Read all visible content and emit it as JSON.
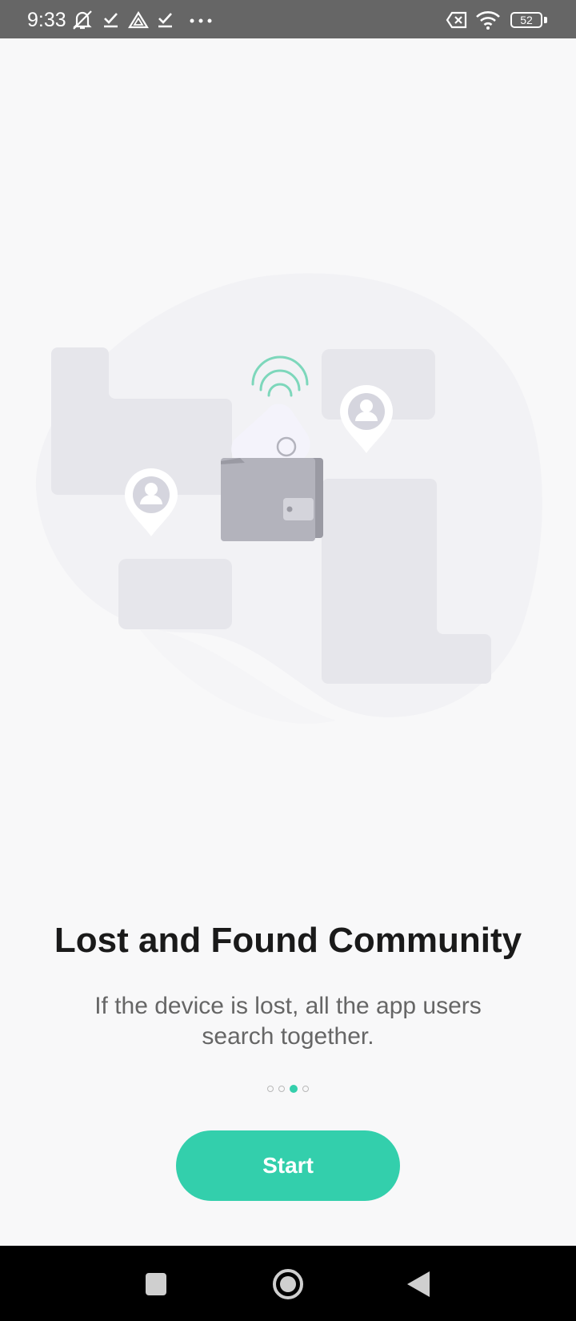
{
  "status_bar": {
    "time": "9:33",
    "battery": "52"
  },
  "onboarding": {
    "title": "Lost and Found Community",
    "subtitle": "If the device is lost, all the app users search together.",
    "page_count": 4,
    "active_page": 3,
    "start_label": "Start"
  },
  "colors": {
    "accent": "#33cfac",
    "status_bar": "#666666",
    "background": "#f8f8f9"
  },
  "icons": {
    "status_left": [
      "mute-icon",
      "check-icon",
      "drive-icon",
      "check-icon",
      "more-dots-icon"
    ],
    "status_right": [
      "no-sim-icon",
      "wifi-icon",
      "battery-icon"
    ],
    "nav": [
      "recents-icon",
      "home-icon",
      "back-icon"
    ]
  }
}
